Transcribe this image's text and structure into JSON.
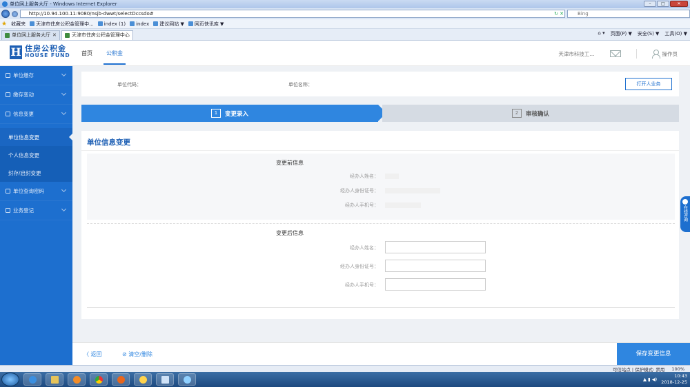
{
  "browser": {
    "title": "单位网上服务大厅 - Windows Internet Explorer",
    "url": "http://10.94.100.11:9080/nsjb-dwwt/selectDccsdo#",
    "search_placeholder": "Bing",
    "favorites_label": "收藏夹",
    "favorites": [
      "天津市住房公积金管理中...",
      "index (1)",
      "index",
      "建议网站 ▼",
      "网页快讯库 ▼"
    ],
    "tabs": [
      "单位网上服务大厅",
      "天津市住房公积金管理中心"
    ],
    "commands": [
      "页面(P) ▼",
      "安全(S) ▼",
      "工具(O) ▼"
    ],
    "status": "可信站点 | 保护模式: 禁用",
    "zoom": "100%"
  },
  "app": {
    "brand_cn": "住房公积金",
    "brand_en": "HOUSE FUND",
    "nav": [
      "首页",
      "公积金"
    ],
    "active_nav": "公积金",
    "org_name": "天津市科技工...",
    "user_label": "操作员"
  },
  "sidebar": {
    "items": [
      {
        "label": "单位缴存"
      },
      {
        "label": "缴存变动"
      },
      {
        "label": "信息变更"
      }
    ],
    "subitems": [
      {
        "label": "单位信息变更"
      },
      {
        "label": "个人信息变更"
      },
      {
        "label": "封存/启封变更"
      }
    ],
    "items_after": [
      {
        "label": "单位查询密码"
      },
      {
        "label": "业务登记"
      }
    ]
  },
  "unit_bar": {
    "code_label": "单位代码：",
    "name_label": "单位名称：",
    "button": "打开人业务"
  },
  "steps": [
    {
      "num": "1",
      "label": "变更录入"
    },
    {
      "num": "2",
      "label": "审核确认"
    }
  ],
  "form": {
    "title": "单位信息变更",
    "before_title": "变更前信息",
    "after_title": "变更后信息",
    "labels": [
      "经办人姓名：",
      "经办人身份证号：",
      "经办人手机号："
    ]
  },
  "footer": {
    "back": "〈 返回",
    "clear": "⊘ 清空/删除",
    "save": "保存变更信息"
  },
  "float_tab": "在线咨询",
  "taskbar": {
    "time": "10:43",
    "date": "2018-12-25"
  },
  "colors": {
    "primary": "#1d6fcf",
    "step_active": "#2f86e0",
    "step_inactive": "#d5dbe3"
  }
}
